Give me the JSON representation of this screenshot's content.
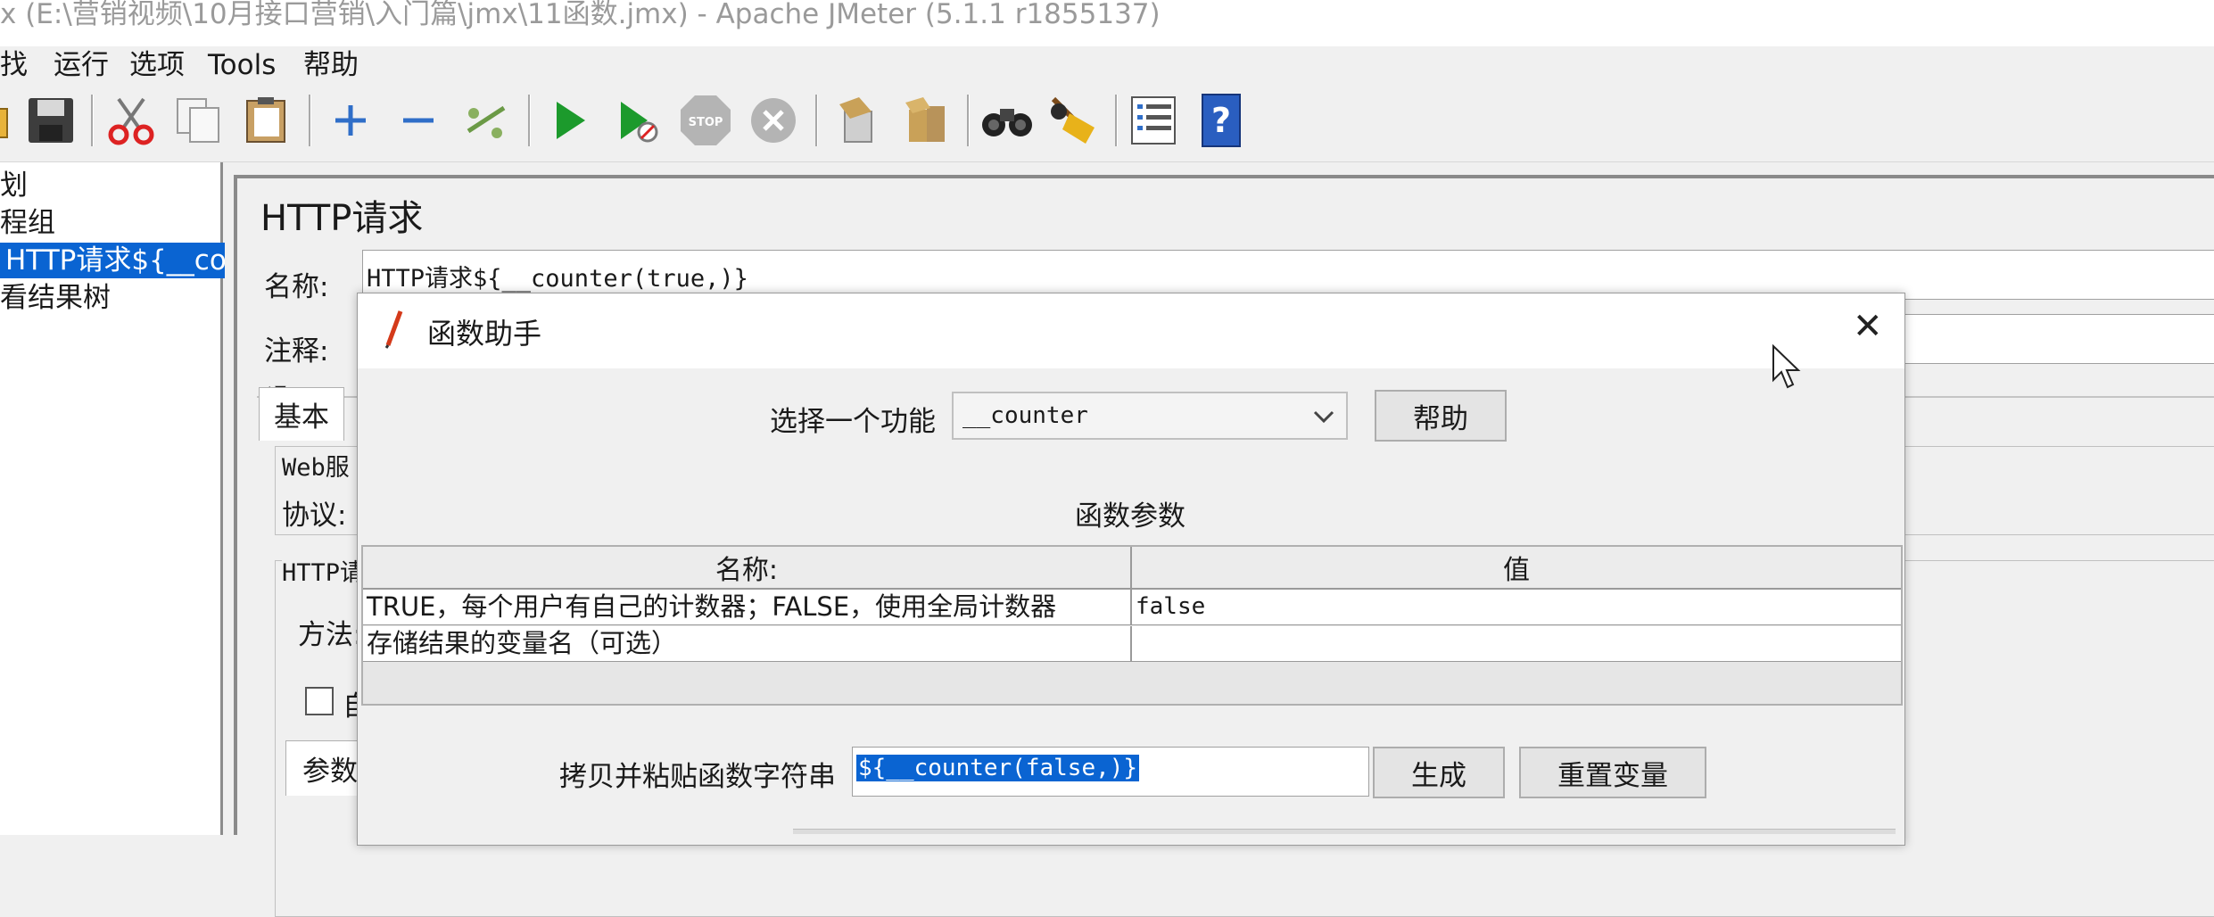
{
  "window": {
    "title": "x (E:\\营销视频\\10月接口营销\\入门篇\\jmx\\11函数.jmx) - Apache JMeter (5.1.1 r1855137)"
  },
  "menu": {
    "items": [
      "找",
      "运行",
      "选项",
      "Tools",
      "帮助"
    ]
  },
  "toolbar": {
    "icons": [
      "open-icon",
      "save-icon",
      "cut-icon",
      "copy-icon",
      "paste-icon",
      "expand-icon",
      "collapse-icon",
      "toggle-icon",
      "start-icon",
      "start-no-pause-icon",
      "stop-icon",
      "shutdown-icon",
      "clear-icon",
      "clear-all-icon",
      "search-icon",
      "reset-search-icon",
      "function-helper-icon",
      "help-icon"
    ],
    "stop_label": "STOP"
  },
  "tree": {
    "items": [
      "划",
      "程组",
      "HTTP请求${__cou",
      "看结果树"
    ],
    "selected_index": 2
  },
  "sampler": {
    "title": "HTTP请求",
    "name_label": "名称:",
    "name_value": "HTTP请求${__counter(true,)}",
    "comment_label": "注释:",
    "tab_basic": "基本",
    "web_server_label": "Web服",
    "protocol_label": "协议:",
    "http_request_label": "HTTP请",
    "method_label": "方法:",
    "auto_label": "自",
    "params_tab": "参数"
  },
  "dialog": {
    "title": "函数助手",
    "select_function_label": "选择一个功能",
    "selected_function": "__counter",
    "help_button": "帮助",
    "params_section_title": "函数参数",
    "table_headers": [
      "名称:",
      "值"
    ],
    "table_rows": [
      [
        "TRUE，每个用户有自己的计数器；FALSE，使用全局计数器",
        "false"
      ],
      [
        "存储结果的变量名（可选）",
        ""
      ]
    ],
    "copy_paste_label": "拷贝并粘贴函数字符串",
    "function_string": "${__counter(false,)}",
    "generate_button": "生成",
    "reset_button": "重置变量",
    "close_glyph": "✕"
  },
  "colors": {
    "selection": "#0a64d2",
    "selection_text": "#ffffff",
    "run_green": "#1c9a2c",
    "help_blue": "#2a5ec0"
  }
}
